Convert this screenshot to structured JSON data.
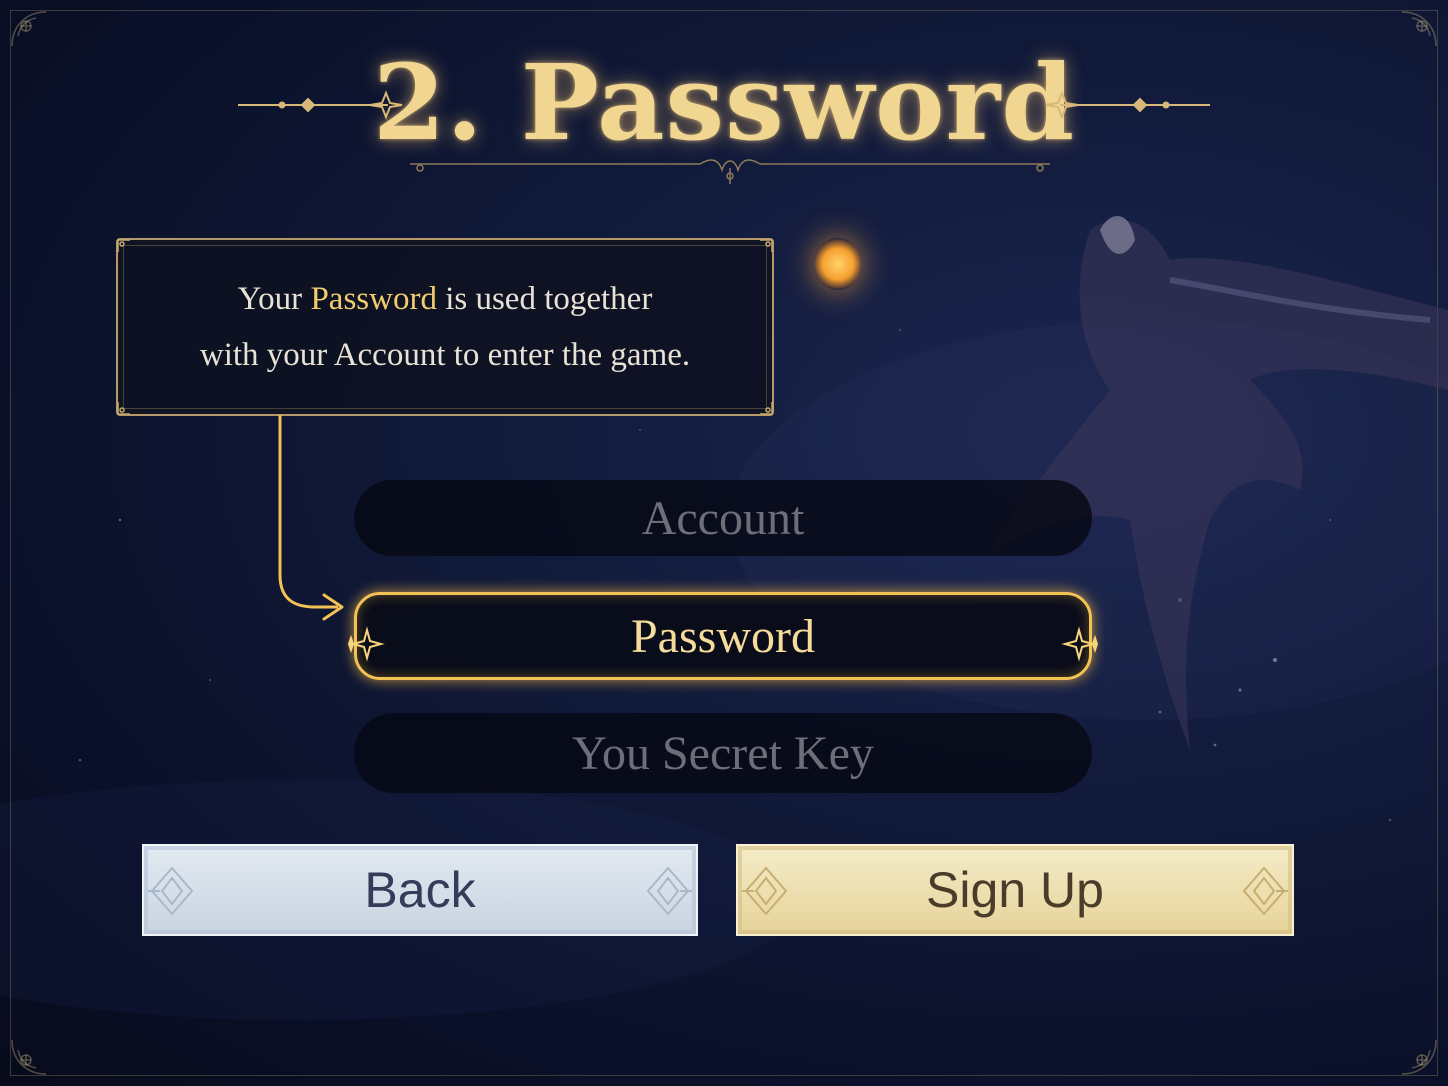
{
  "screen": {
    "title": "2. Password"
  },
  "tooltip": {
    "line1_before": "Your ",
    "line1_highlight": "Password",
    "line1_after": " is used together",
    "line2": "with your Account to enter the game."
  },
  "form": {
    "fields": [
      {
        "label": "Account",
        "state": "inactive"
      },
      {
        "label": "Password",
        "state": "active"
      },
      {
        "label": "You Secret Key",
        "state": "inactive"
      }
    ]
  },
  "buttons": {
    "back_label": "Back",
    "signup_label": "Sign Up"
  },
  "colors": {
    "background": "#0e1530",
    "accent_gold": "#f2c254",
    "title_gold": "#f0d690",
    "back_button": "#d5dee9",
    "signup_button": "#ede0b2"
  }
}
